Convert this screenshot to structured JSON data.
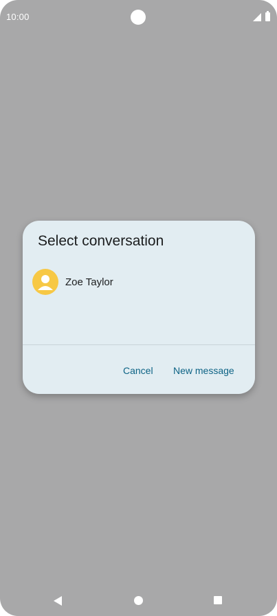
{
  "status_bar": {
    "time": "10:00",
    "icons": [
      "camera-cutout",
      "signal-icon",
      "battery-icon"
    ]
  },
  "dialog": {
    "title": "Select conversation",
    "contacts": [
      {
        "name": "Zoe Taylor",
        "avatar_icon": "person-icon",
        "avatar_color": "#f7c845"
      }
    ],
    "buttons": {
      "cancel": "Cancel",
      "new_message": "New message"
    },
    "accent_color": "#0d6385",
    "background_color": "#e2edf2"
  },
  "nav_bar": {
    "icons": [
      "back-icon",
      "home-icon",
      "recents-icon"
    ]
  },
  "colors": {
    "scrim": "#a8a8a9"
  }
}
